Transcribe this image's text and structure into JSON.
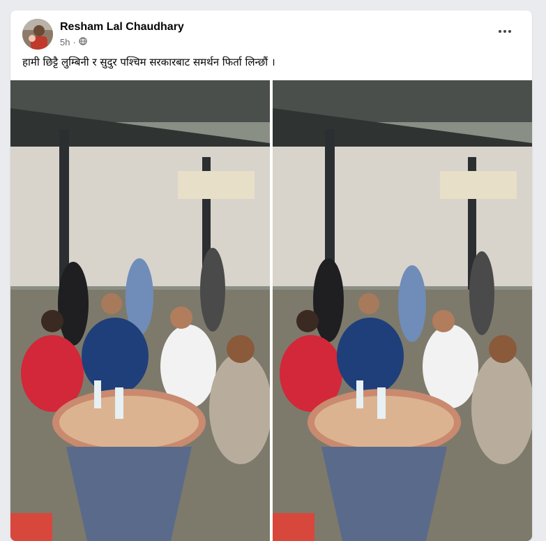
{
  "post": {
    "author": "Resham Lal Chaudhary",
    "time": "5h",
    "audience_icon": "globe-icon",
    "more_icon": "more-options-icon",
    "caption": "हामी छिट्टै लुम्बिनी र सुदुर पश्चिम सरकारबाट समर्थन फिर्ता लिन्छौं ।",
    "photo_count": 2
  },
  "colors": {
    "background": "#e9ebee",
    "card": "#ffffff",
    "text_primary": "#050505",
    "text_secondary": "#65676b"
  }
}
